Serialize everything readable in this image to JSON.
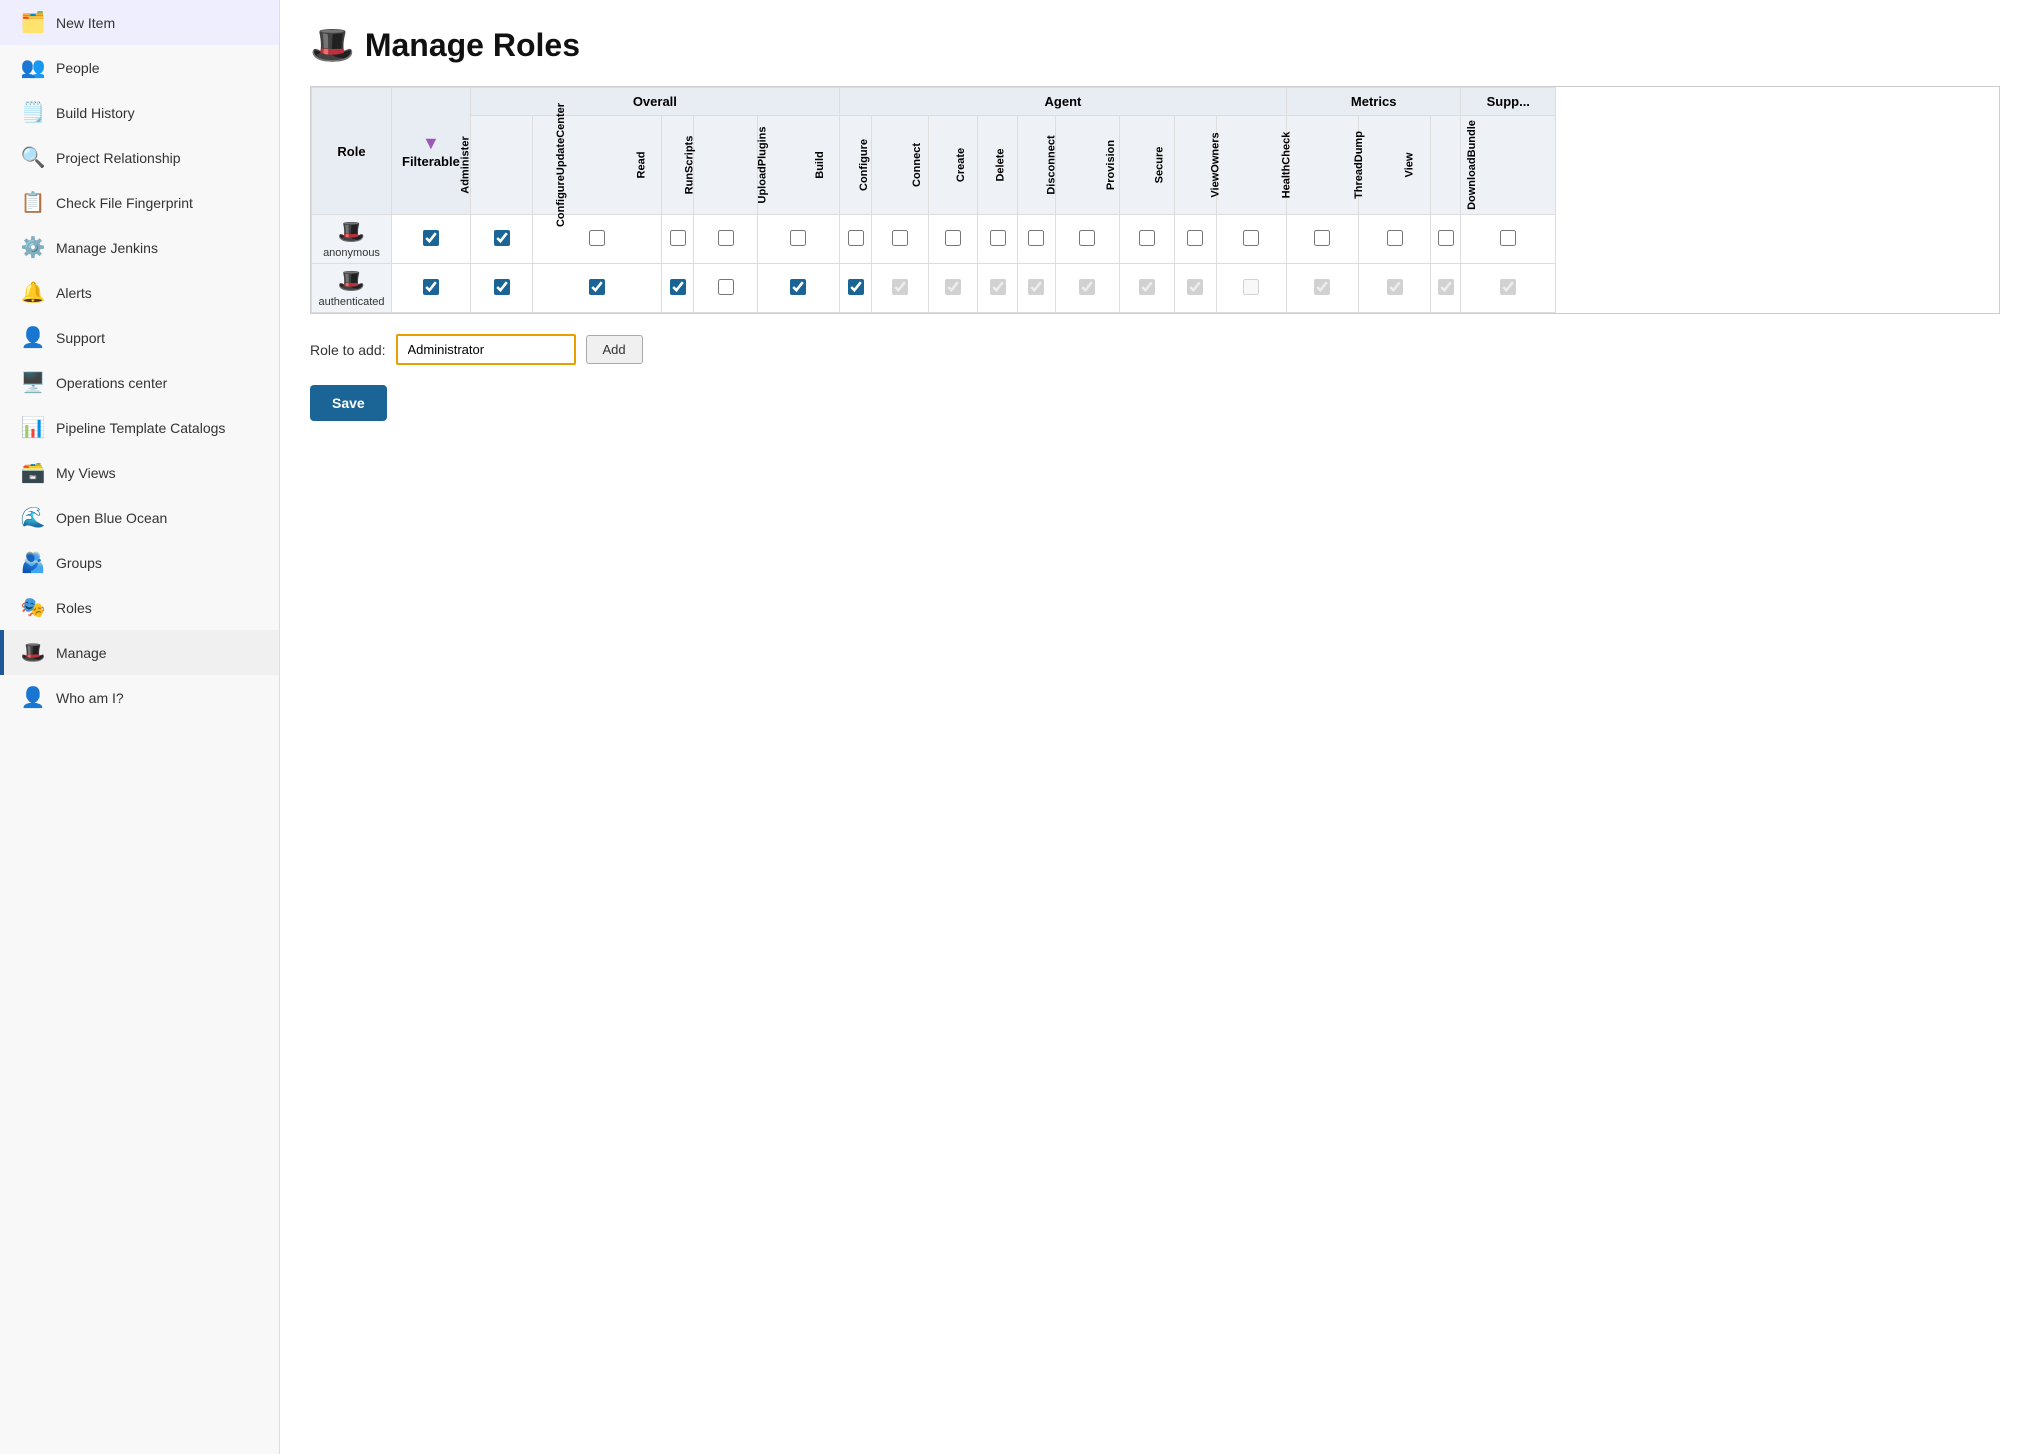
{
  "sidebar": {
    "items": [
      {
        "id": "new-item",
        "label": "New Item",
        "icon": "🗂️",
        "active": false
      },
      {
        "id": "people",
        "label": "People",
        "icon": "👥",
        "active": false
      },
      {
        "id": "build-history",
        "label": "Build History",
        "icon": "🗒️",
        "active": false
      },
      {
        "id": "project-relationship",
        "label": "Project Relationship",
        "icon": "🔍",
        "active": false
      },
      {
        "id": "check-file-fingerprint",
        "label": "Check File Fingerprint",
        "icon": "📋",
        "active": false
      },
      {
        "id": "manage-jenkins",
        "label": "Manage Jenkins",
        "icon": "⚙️",
        "active": false
      },
      {
        "id": "alerts",
        "label": "Alerts",
        "icon": "🔔",
        "active": false
      },
      {
        "id": "support",
        "label": "Support",
        "icon": "👤",
        "active": false
      },
      {
        "id": "operations-center",
        "label": "Operations center",
        "icon": "🖥️",
        "active": false
      },
      {
        "id": "pipeline-template-catalogs",
        "label": "Pipeline Template Catalogs",
        "icon": "📊",
        "active": false
      },
      {
        "id": "my-views",
        "label": "My Views",
        "icon": "🗃️",
        "active": false
      },
      {
        "id": "open-blue-ocean",
        "label": "Open Blue Ocean",
        "icon": "🌊",
        "active": false
      },
      {
        "id": "groups",
        "label": "Groups",
        "icon": "🫂",
        "active": false
      },
      {
        "id": "roles",
        "label": "Roles",
        "icon": "🎭",
        "active": false
      },
      {
        "id": "manage",
        "label": "Manage",
        "icon": "🎩",
        "active": true
      },
      {
        "id": "who-am-i",
        "label": "Who am I?",
        "icon": "👤",
        "active": false
      }
    ]
  },
  "page": {
    "title": "Manage Roles",
    "title_icon": "🎩"
  },
  "table": {
    "col_role": "Role",
    "col_filterable": "Filterable",
    "group_overall": "Overall",
    "group_agent": "Agent",
    "group_metrics": "Metrics",
    "group_support": "Supp...",
    "overall_cols": [
      "Administer",
      "ConfigureUpdateCenter",
      "Read",
      "RunScripts",
      "UploadPlugins"
    ],
    "agent_cols": [
      "Build",
      "Configure",
      "Connect",
      "Create",
      "Delete",
      "Disconnect",
      "Provision",
      "Secure",
      "ViewOwners"
    ],
    "metrics_cols": [
      "HealthCheck",
      "ThreadDump",
      "View"
    ],
    "support_cols": [
      "DownloadBundle"
    ],
    "rows": [
      {
        "name": "anonymous",
        "icon": "🎩",
        "filterable": true,
        "overall": [
          true,
          false,
          false,
          false,
          false
        ],
        "agent": [
          false,
          false,
          false,
          false,
          false,
          false,
          false,
          false,
          false
        ],
        "metrics": [
          false,
          false,
          false
        ],
        "support": [
          false
        ],
        "overall_disabled": [
          false,
          false,
          false,
          false,
          false
        ],
        "agent_disabled": [
          false,
          false,
          false,
          false,
          false,
          false,
          false,
          false,
          false
        ],
        "metrics_disabled": [
          false,
          false,
          false
        ],
        "support_disabled": [
          false
        ]
      },
      {
        "name": "authenticated",
        "icon": "🎩",
        "filterable": true,
        "overall": [
          true,
          true,
          true,
          false,
          true
        ],
        "agent": [
          true,
          true,
          true,
          true,
          true,
          true,
          true,
          true,
          false
        ],
        "metrics": [
          true,
          true,
          true
        ],
        "support": [
          true
        ],
        "overall_disabled": [
          false,
          false,
          false,
          false,
          false
        ],
        "agent_disabled": [
          false,
          true,
          true,
          true,
          true,
          true,
          true,
          true,
          true
        ],
        "metrics_disabled": [
          true,
          true,
          true
        ],
        "support_disabled": [
          true
        ]
      }
    ]
  },
  "role_add": {
    "label": "Role to add:",
    "placeholder": "Administrator",
    "value": "Administrator",
    "add_button": "Add"
  },
  "save_button": "Save"
}
